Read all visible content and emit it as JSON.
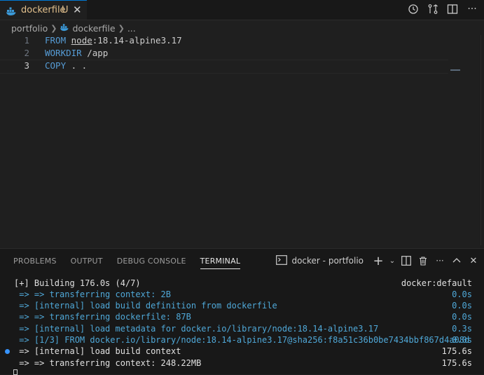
{
  "tab": {
    "filename": "dockerfile",
    "status": "U"
  },
  "breadcrumb": {
    "folder": "portfolio",
    "file": "dockerfile",
    "more": "..."
  },
  "editor": {
    "lines": [
      {
        "num": "1",
        "kw": "FROM",
        "rest_a": " ",
        "underlined": "node",
        "rest_b": ":18.14-alpine3.17"
      },
      {
        "num": "2",
        "kw": "WORKDIR",
        "rest": " /app"
      },
      {
        "num": "3",
        "kw": "COPY",
        "rest": " . ."
      }
    ]
  },
  "panel": {
    "tabs": [
      "PROBLEMS",
      "OUTPUT",
      "DEBUG CONSOLE",
      "TERMINAL"
    ],
    "active_tab": "TERMINAL",
    "terminal_name": "docker - portfolio"
  },
  "terminal": {
    "lines": [
      {
        "text": "[+] Building 176.0s (4/7)",
        "right": "docker:default",
        "color": "white"
      },
      {
        "text": " => => transferring context: 2B",
        "right": "0.0s",
        "color": "blue"
      },
      {
        "text": " => [internal] load build definition from dockerfile",
        "right": "0.0s",
        "color": "blue"
      },
      {
        "text": " => => transferring dockerfile: 87B",
        "right": "0.0s",
        "color": "blue"
      },
      {
        "text": " => [internal] load metadata for docker.io/library/node:18.14-alpine3.17",
        "right": "0.3s",
        "color": "blue"
      },
      {
        "text": " => [1/3] FROM docker.io/library/node:18.14-alpine3.17@sha256:f8a51c36b0be7434bbf867d4a08d",
        "right": "0.0s",
        "color": "blue"
      },
      {
        "text": " => [internal] load build context",
        "right": "175.6s",
        "color": "white"
      },
      {
        "text": " => => transferring context: 248.22MB",
        "right": "175.6s",
        "color": "white"
      }
    ]
  },
  "colors": {
    "keyword": "#569cd6",
    "terminal_blue": "#4fa8d8",
    "modified": "#e2c08d",
    "accent": "#0078d4"
  }
}
